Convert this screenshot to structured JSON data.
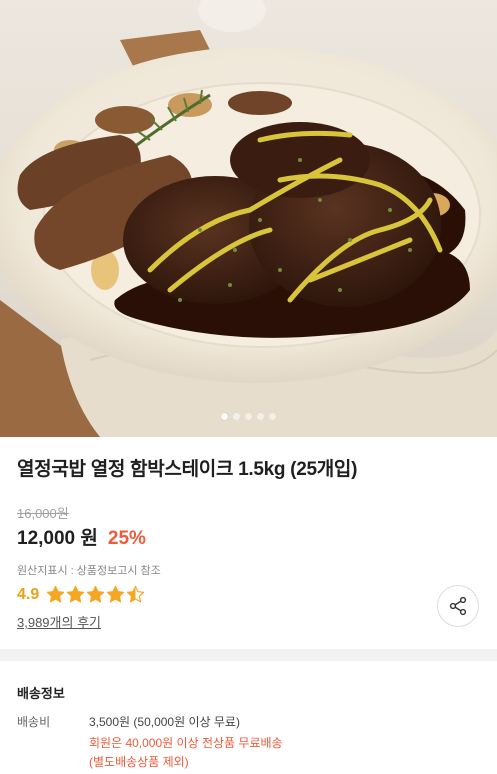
{
  "product": {
    "title": "열정국밥 열정 함박스테이크 1.5kg (25개입)",
    "original_price": "16,000원",
    "price": "12,000 원",
    "discount": "25%",
    "origin_notice": "원산지표시 : 상품정보고시 참조",
    "rating": "4.9",
    "rating_value": 4.5,
    "rating_max": 5,
    "reviews": "3,989개의 후기",
    "share_icon": "share-icon",
    "star_color": "#f5a623",
    "accent_color": "#f05a3a"
  },
  "gallery": {
    "image": "hamburg-steak-plate",
    "slide_count": 5,
    "active_slide": 1
  },
  "shipping": {
    "heading": "배송정보",
    "label": "배송비",
    "fee": "3,500원 (50,000원 이상 무료)",
    "member_notice": "회원은 40,000원 이상 전상품 무료배송",
    "exception": "(별도배송상품 제외)"
  }
}
